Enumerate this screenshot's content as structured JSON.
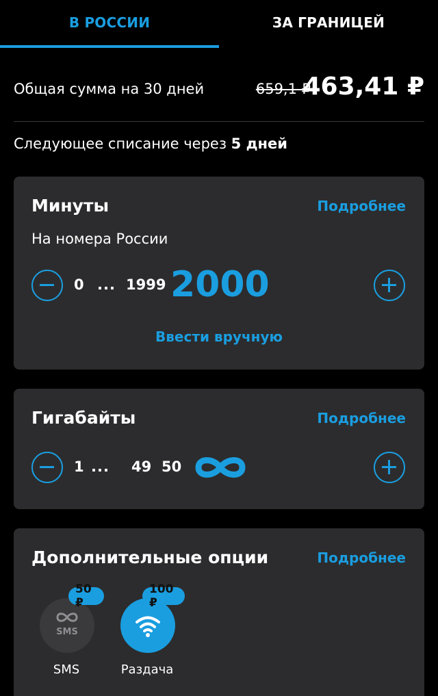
{
  "tabs": [
    {
      "label": "В РОССИИ",
      "active": true
    },
    {
      "label": "ЗА ГРАНИЦЕЙ",
      "active": false
    }
  ],
  "summary": {
    "label": "Общая сумма на 30 дней",
    "old_price": "659,1 ₽",
    "new_price": "463,41 ₽"
  },
  "next_charge": {
    "prefix": "Следующее списание через ",
    "value": "5 дней"
  },
  "minutes": {
    "title": "Минуты",
    "details_link": "Подробнее",
    "subtitle": "На номера России",
    "scale_start": "0",
    "scale_dots": "...",
    "scale_prev": "1999",
    "selected": "2000",
    "manual_link": "Ввести вручную"
  },
  "gigabytes": {
    "title": "Гигабайты",
    "details_link": "Подробнее",
    "scale_start": "1",
    "scale_dots": "...",
    "scale_prev": "49",
    "scale_next": "50",
    "selected_icon": "infinity-icon"
  },
  "extras": {
    "title": "Дополнительные опции",
    "details_link": "Подробнее",
    "options": [
      {
        "label": "SMS",
        "price": "50 ₽",
        "icon": "infinity-sms-icon",
        "sub": "SMS",
        "active": false
      },
      {
        "label": "Раздача",
        "price": "100 ₽",
        "icon": "wifi-icon",
        "active": true
      }
    ]
  },
  "colors": {
    "accent": "#1a9ee0",
    "background": "#000000",
    "card": "#2c2c2e",
    "inactive_option": "#3a3a3c"
  }
}
